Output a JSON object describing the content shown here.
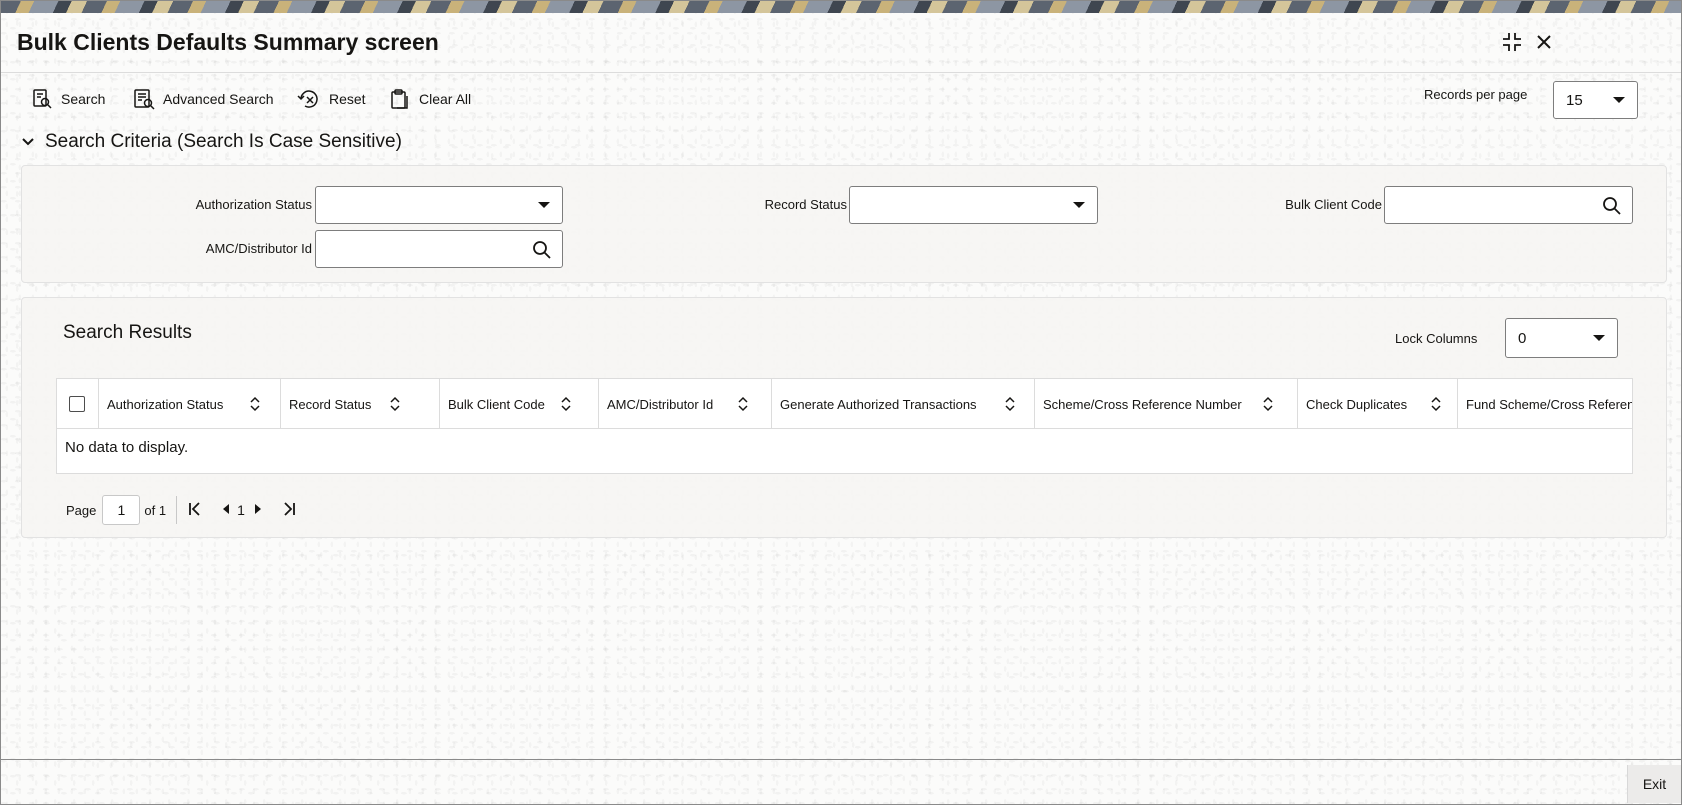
{
  "window": {
    "title": "Bulk Clients Defaults Summary screen"
  },
  "icons": {
    "minimize": "collapse-icon",
    "close": "close-icon"
  },
  "toolbar": {
    "search_label": "Search",
    "advanced_search_label": "Advanced Search",
    "reset_label": "Reset",
    "clear_all_label": "Clear All",
    "records_per_page_label": "Records per page",
    "records_per_page_value": "15"
  },
  "criteria": {
    "section_title": "Search Criteria (Search Is Case Sensitive)",
    "authorization_status_label": "Authorization Status",
    "authorization_status_value": "",
    "record_status_label": "Record Status",
    "record_status_value": "",
    "bulk_client_code_label": "Bulk Client Code",
    "bulk_client_code_value": "",
    "amc_distributor_id_label": "AMC/Distributor Id",
    "amc_distributor_id_value": ""
  },
  "results": {
    "title": "Search Results",
    "lock_columns_label": "Lock Columns",
    "lock_columns_value": "0",
    "columns": [
      "Authorization Status",
      "Record Status",
      "Bulk Client Code",
      "AMC/Distributor Id",
      "Generate Authorized Transactions",
      "Scheme/Cross Reference Number",
      "Check Duplicates",
      "Fund Scheme/Cross Reference"
    ],
    "empty_message": "No data to display."
  },
  "pagination": {
    "page_label": "Page",
    "current_page": "1",
    "of_label": "of 1",
    "page_number": "1"
  },
  "footer": {
    "exit_label": "Exit"
  },
  "colors": {
    "text": "#161513",
    "border": "#7d7d7d",
    "panel_bg": "#f6f5f3"
  }
}
